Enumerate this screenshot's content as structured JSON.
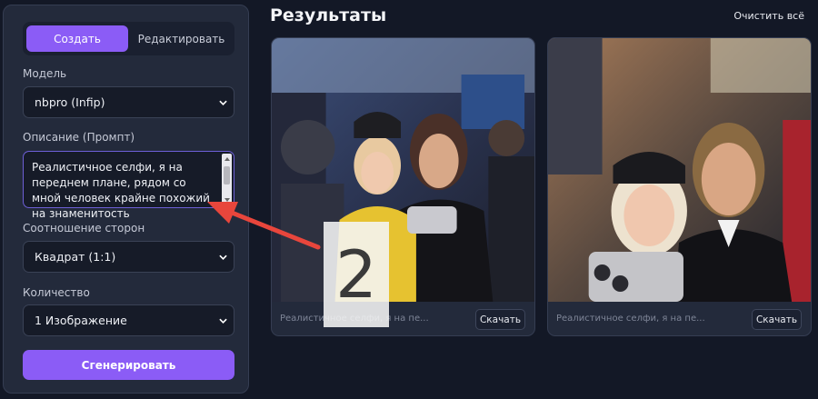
{
  "sidebar": {
    "tabs": {
      "create": "Создать",
      "edit": "Редактировать"
    },
    "model": {
      "label": "Модель",
      "value": "nbpro (Infip)"
    },
    "prompt": {
      "label": "Описание (Промпт)",
      "value": "Реалистичное селфи, я на переднем плане, рядом со мной человек крайне похожий на знаменитость"
    },
    "aspect": {
      "label": "Соотношение сторон",
      "value": "Квадрат (1:1)"
    },
    "count": {
      "label": "Количество",
      "value": "1 Изображение"
    },
    "generate_label": "Сгенерировать"
  },
  "main": {
    "title": "Результаты",
    "clear_label": "Очистить всё",
    "cards": [
      {
        "caption": "Реалистичное селфи, я на пе...",
        "download_label": "Скачать"
      },
      {
        "caption": "Реалистичное селфи, я на пе...",
        "download_label": "Скачать"
      }
    ]
  },
  "annotation": {
    "step_number": "2",
    "arrow_color": "#e8463c"
  },
  "colors": {
    "accent": "#8b5cf6",
    "panel": "#232a3b",
    "background": "#131826"
  },
  "icons": {
    "select_chevron": "chevron-down-icon"
  }
}
